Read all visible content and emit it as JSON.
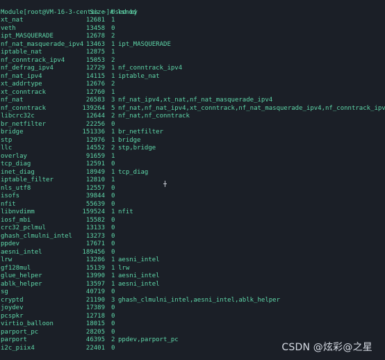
{
  "prompt": "[root@VM-16-3-centos ~]# lsmod",
  "header": {
    "module": "Module",
    "size": "Size",
    "used_by": "Used by"
  },
  "rows": [
    {
      "module": "xt_nat",
      "size": "12681",
      "used": "1",
      "by": ""
    },
    {
      "module": "veth",
      "size": "13458",
      "used": "0",
      "by": ""
    },
    {
      "module": "ipt_MASQUERADE",
      "size": "12678",
      "used": "2",
      "by": ""
    },
    {
      "module": "nf_nat_masquerade_ipv4",
      "size": "13463",
      "used": "1",
      "by": "ipt_MASQUERADE"
    },
    {
      "module": "iptable_nat",
      "size": "12875",
      "used": "1",
      "by": ""
    },
    {
      "module": "nf_conntrack_ipv4",
      "size": "15053",
      "used": "2",
      "by": ""
    },
    {
      "module": "nf_defrag_ipv4",
      "size": "12729",
      "used": "1",
      "by": "nf_conntrack_ipv4"
    },
    {
      "module": "nf_nat_ipv4",
      "size": "14115",
      "used": "1",
      "by": "iptable_nat"
    },
    {
      "module": "xt_addrtype",
      "size": "12676",
      "used": "2",
      "by": ""
    },
    {
      "module": "xt_conntrack",
      "size": "12760",
      "used": "1",
      "by": ""
    },
    {
      "module": "nf_nat",
      "size": "26583",
      "used": "3",
      "by": "nf_nat_ipv4,xt_nat,nf_nat_masquerade_ipv4"
    },
    {
      "module": "nf_conntrack",
      "size": "139264",
      "used": "5",
      "by": "nf_nat,nf_nat_ipv4,xt_conntrack,nf_nat_masquerade_ipv4,nf_conntrack_ipv4"
    },
    {
      "module": "libcrc32c",
      "size": "12644",
      "used": "2",
      "by": "nf_nat,nf_conntrack"
    },
    {
      "module": "br_netfilter",
      "size": "22256",
      "used": "0",
      "by": ""
    },
    {
      "module": "bridge",
      "size": "151336",
      "used": "1",
      "by": "br_netfilter"
    },
    {
      "module": "stp",
      "size": "12976",
      "used": "1",
      "by": "bridge"
    },
    {
      "module": "llc",
      "size": "14552",
      "used": "2",
      "by": "stp,bridge"
    },
    {
      "module": "overlay",
      "size": "91659",
      "used": "1",
      "by": ""
    },
    {
      "module": "tcp_diag",
      "size": "12591",
      "used": "0",
      "by": ""
    },
    {
      "module": "inet_diag",
      "size": "18949",
      "used": "1",
      "by": "tcp_diag"
    },
    {
      "module": "iptable_filter",
      "size": "12810",
      "used": "1",
      "by": ""
    },
    {
      "module": "nls_utf8",
      "size": "12557",
      "used": "0",
      "by": ""
    },
    {
      "module": "isofs",
      "size": "39844",
      "used": "0",
      "by": ""
    },
    {
      "module": "nfit",
      "size": "55639",
      "used": "0",
      "by": ""
    },
    {
      "module": "libnvdimm",
      "size": "159524",
      "used": "1",
      "by": "nfit"
    },
    {
      "module": "iosf_mbi",
      "size": "15582",
      "used": "0",
      "by": ""
    },
    {
      "module": "crc32_pclmul",
      "size": "13133",
      "used": "0",
      "by": ""
    },
    {
      "module": "ghash_clmulni_intel",
      "size": "13273",
      "used": "0",
      "by": ""
    },
    {
      "module": "ppdev",
      "size": "17671",
      "used": "0",
      "by": ""
    },
    {
      "module": "aesni_intel",
      "size": "189456",
      "used": "0",
      "by": ""
    },
    {
      "module": "lrw",
      "size": "13286",
      "used": "1",
      "by": "aesni_intel"
    },
    {
      "module": "gf128mul",
      "size": "15139",
      "used": "1",
      "by": "lrw"
    },
    {
      "module": "glue_helper",
      "size": "13990",
      "used": "1",
      "by": "aesni_intel"
    },
    {
      "module": "ablk_helper",
      "size": "13597",
      "used": "1",
      "by": "aesni_intel"
    },
    {
      "module": "sg",
      "size": "40719",
      "used": "0",
      "by": ""
    },
    {
      "module": "cryptd",
      "size": "21190",
      "used": "3",
      "by": "ghash_clmulni_intel,aesni_intel,ablk_helper"
    },
    {
      "module": "joydev",
      "size": "17389",
      "used": "0",
      "by": ""
    },
    {
      "module": "pcspkr",
      "size": "12718",
      "used": "0",
      "by": ""
    },
    {
      "module": "virtio_balloon",
      "size": "18015",
      "used": "0",
      "by": ""
    },
    {
      "module": "parport_pc",
      "size": "28205",
      "used": "0",
      "by": ""
    },
    {
      "module": "parport",
      "size": "46395",
      "used": "2",
      "by": "ppdev,parport_pc"
    },
    {
      "module": "i2c_piix4",
      "size": "22401",
      "used": "0",
      "by": ""
    }
  ],
  "watermark": "CSDN @炫彩@之星",
  "colors": {
    "background": "#1b1f27",
    "text": "#5fd7a9",
    "watermark": "#d8dde6"
  },
  "cursor_icon": "text-cursor-icon"
}
